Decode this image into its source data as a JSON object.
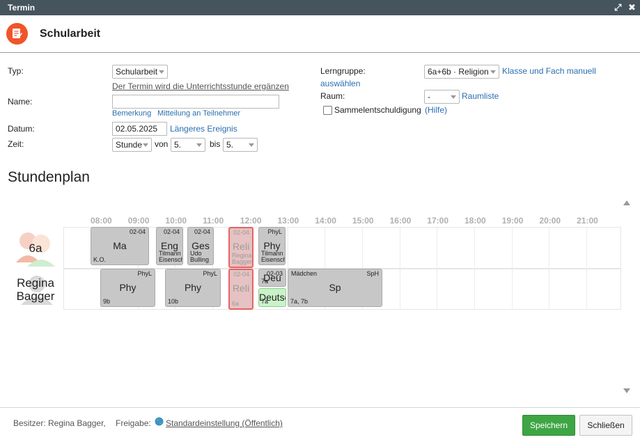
{
  "window": {
    "title": "Termin"
  },
  "header": {
    "title": "Schularbeit"
  },
  "form": {
    "typ_label": "Typ:",
    "typ_value": "Schularbeit",
    "typ_hint": "Der Termin wird die Unterrichtsstunde ergänzen",
    "name_label": "Name:",
    "name_value": "",
    "bemerkung_link": "Bemerkung",
    "mitteilung_link": "Mitteilung an Teilnehmer",
    "datum_label": "Datum:",
    "datum_value": "02.05.2025",
    "laengeres_link": "Längeres Ereignis",
    "zeit_label": "Zeit:",
    "zeit_mode": "Stunde",
    "von_label": "von",
    "von_value": "5.",
    "bis_label": "bis",
    "bis_value": "5.",
    "lerngruppe_label": "Lerngruppe:",
    "lerngruppe_value": "6a+6b · Religion",
    "klasse_link_1": "Klasse und Fach manuell",
    "klasse_link_2": "auswählen",
    "raum_label": "Raum:",
    "raum_value": "-",
    "raumliste_link": "Raumliste",
    "sammel_label": "Sammelentschuldigung",
    "hilfe_link": "(Hilfe)"
  },
  "stundenplan": {
    "title": "Stundenplan",
    "hours": [
      "08:00",
      "09:00",
      "10:00",
      "11:00",
      "12:00",
      "13:00",
      "14:00",
      "15:00",
      "16:00",
      "17:00",
      "18:00",
      "19:00",
      "20:00",
      "21:00"
    ],
    "row1_label": "6a",
    "row2_label_1": "Regina",
    "row2_label_2": "Bagger",
    "events_row1": [
      {
        "subject": "Ma",
        "tr": "02-04",
        "bl1": "K.O.",
        "bl2": ""
      },
      {
        "subject": "Eng",
        "tr": "02-04",
        "bl1": "Tilmann",
        "bl2": "Eisensch"
      },
      {
        "subject": "Ges",
        "tr": "02-04",
        "bl1": "Udo",
        "bl2": "Bulling"
      },
      {
        "subject": "Reli",
        "tr": "02-04",
        "bl1": "Regina",
        "bl2": "Bagger"
      },
      {
        "subject": "Phy",
        "tr": "PhyL",
        "bl1": "Tilmann",
        "bl2": "Eisensch"
      }
    ],
    "events_row2": [
      {
        "subject": "Phy",
        "tr": "PhyL",
        "bl1": "9b"
      },
      {
        "subject": "Phy",
        "tr": "PhyL",
        "bl1": "10b"
      },
      {
        "subject": "Reli",
        "tr": "02-04",
        "bl1": "6a"
      },
      {
        "subject": "Deu",
        "tr": "02-03",
        "bl1": "7a"
      },
      {
        "subject": "Deutsc",
        "tr": "",
        "bl1": "7a"
      },
      {
        "subject": "Sp",
        "tl": "Mädchen",
        "tr": "SpH",
        "bl1": "7a, 7b"
      }
    ]
  },
  "footer": {
    "besitzer": "Besitzer: Regina Bagger,",
    "freigabe_label": "Freigabe:",
    "freigabe_link": "Standardeinstellung (Öffentlich)",
    "save_label": "Speichern",
    "close_label": "Schließen"
  },
  "colors": {
    "accent": "#f0552a",
    "save": "#3ea544",
    "titlebar": "#46545e",
    "link": "#2a6eb0",
    "selected": "#e24a4a"
  }
}
